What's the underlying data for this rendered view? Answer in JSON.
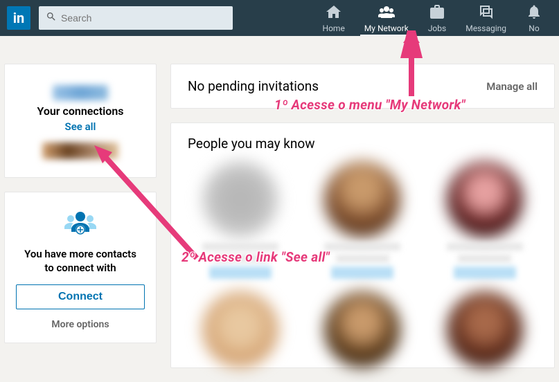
{
  "header": {
    "logo_text": "in",
    "search_placeholder": "Search",
    "nav": [
      {
        "label": "Home",
        "icon": "home-icon"
      },
      {
        "label": "My Network",
        "icon": "network-icon",
        "active": true
      },
      {
        "label": "Jobs",
        "icon": "jobs-icon"
      },
      {
        "label": "Messaging",
        "icon": "messaging-icon"
      },
      {
        "label": "No",
        "icon": "notifications-icon"
      }
    ]
  },
  "sidebar": {
    "connections_title": "Your connections",
    "see_all": "See all",
    "contacts_title_line1": "You have more contacts",
    "contacts_title_line2": "to connect with",
    "connect_button": "Connect",
    "more_options": "More options"
  },
  "main": {
    "invitations_title": "No pending invitations",
    "manage_all": "Manage all",
    "people_title": "People you may know"
  },
  "annotations": {
    "step1": "1º Acesse o menu \"My Network\"",
    "step2": "2º Acesse o link \"See all\"",
    "color": "#e63a7a"
  }
}
